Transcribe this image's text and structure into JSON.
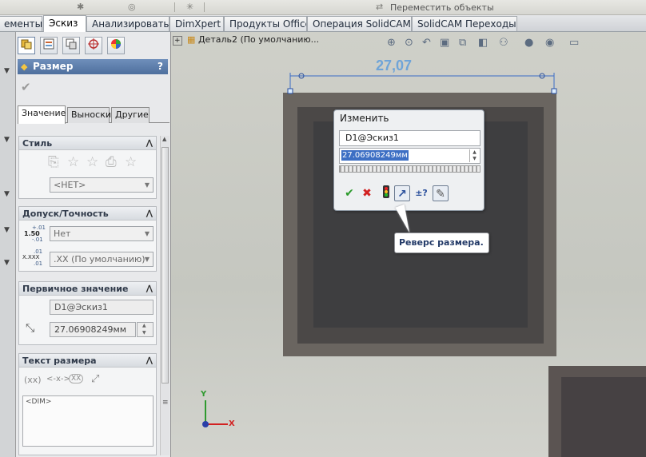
{
  "toolbar": {
    "move_objects_label": "Переместить объекты"
  },
  "tabs": [
    {
      "label": "ементы"
    },
    {
      "label": "Эскиз"
    },
    {
      "label": "Анализировать"
    },
    {
      "label": "DimXpert"
    },
    {
      "label": "Продукты Office"
    },
    {
      "label": "Операция SolidCAM"
    },
    {
      "label": "SolidCAM Переходы"
    }
  ],
  "property_manager": {
    "title": "Размер",
    "help": "?",
    "sub_tabs": [
      "Значение",
      "Выноски",
      "Другие"
    ],
    "style_group": {
      "header": "Стиль",
      "style_select": "<НЕТ>"
    },
    "tolerance_group": {
      "header": "Допуск/Точность",
      "tolerance_select": "Нет",
      "precision_select": ".XX (По умолчанию)",
      "tol_icon_top": "+.01",
      "tol_icon_mid": "1.50",
      "tol_icon_bot": "-.01",
      "prec_icon_top": ".01",
      "prec_icon_mid": "X.XXX",
      "prec_icon_bot": ".01"
    },
    "primary_value_group": {
      "header": "Первичное значение",
      "name": "D1@Эскиз1",
      "value": "27.06908249мм"
    },
    "dim_text_group": {
      "header": "Текст размера",
      "btn_xx_paren": "(xx)",
      "btn_arrows": "<-x->",
      "btn_xx_box": "XX",
      "text": "<DIM>"
    }
  },
  "canvas": {
    "tree_label": "Деталь2  (По умолчанию...",
    "dimension_value": "27,07",
    "axis_y": "Y",
    "axis_x": "X"
  },
  "modify_dialog": {
    "title": "Изменить",
    "dim_name": "D1@Эскиз1",
    "value": "27.06908249мм"
  },
  "tooltip": {
    "text": "Реверс размера."
  },
  "colors": {
    "title_bar": "#4e6f9d",
    "dimension_blue": "#6fa4d8",
    "selection": "#3d6fc4",
    "ok_green": "#2b9a2b",
    "cancel_red": "#d22121"
  }
}
